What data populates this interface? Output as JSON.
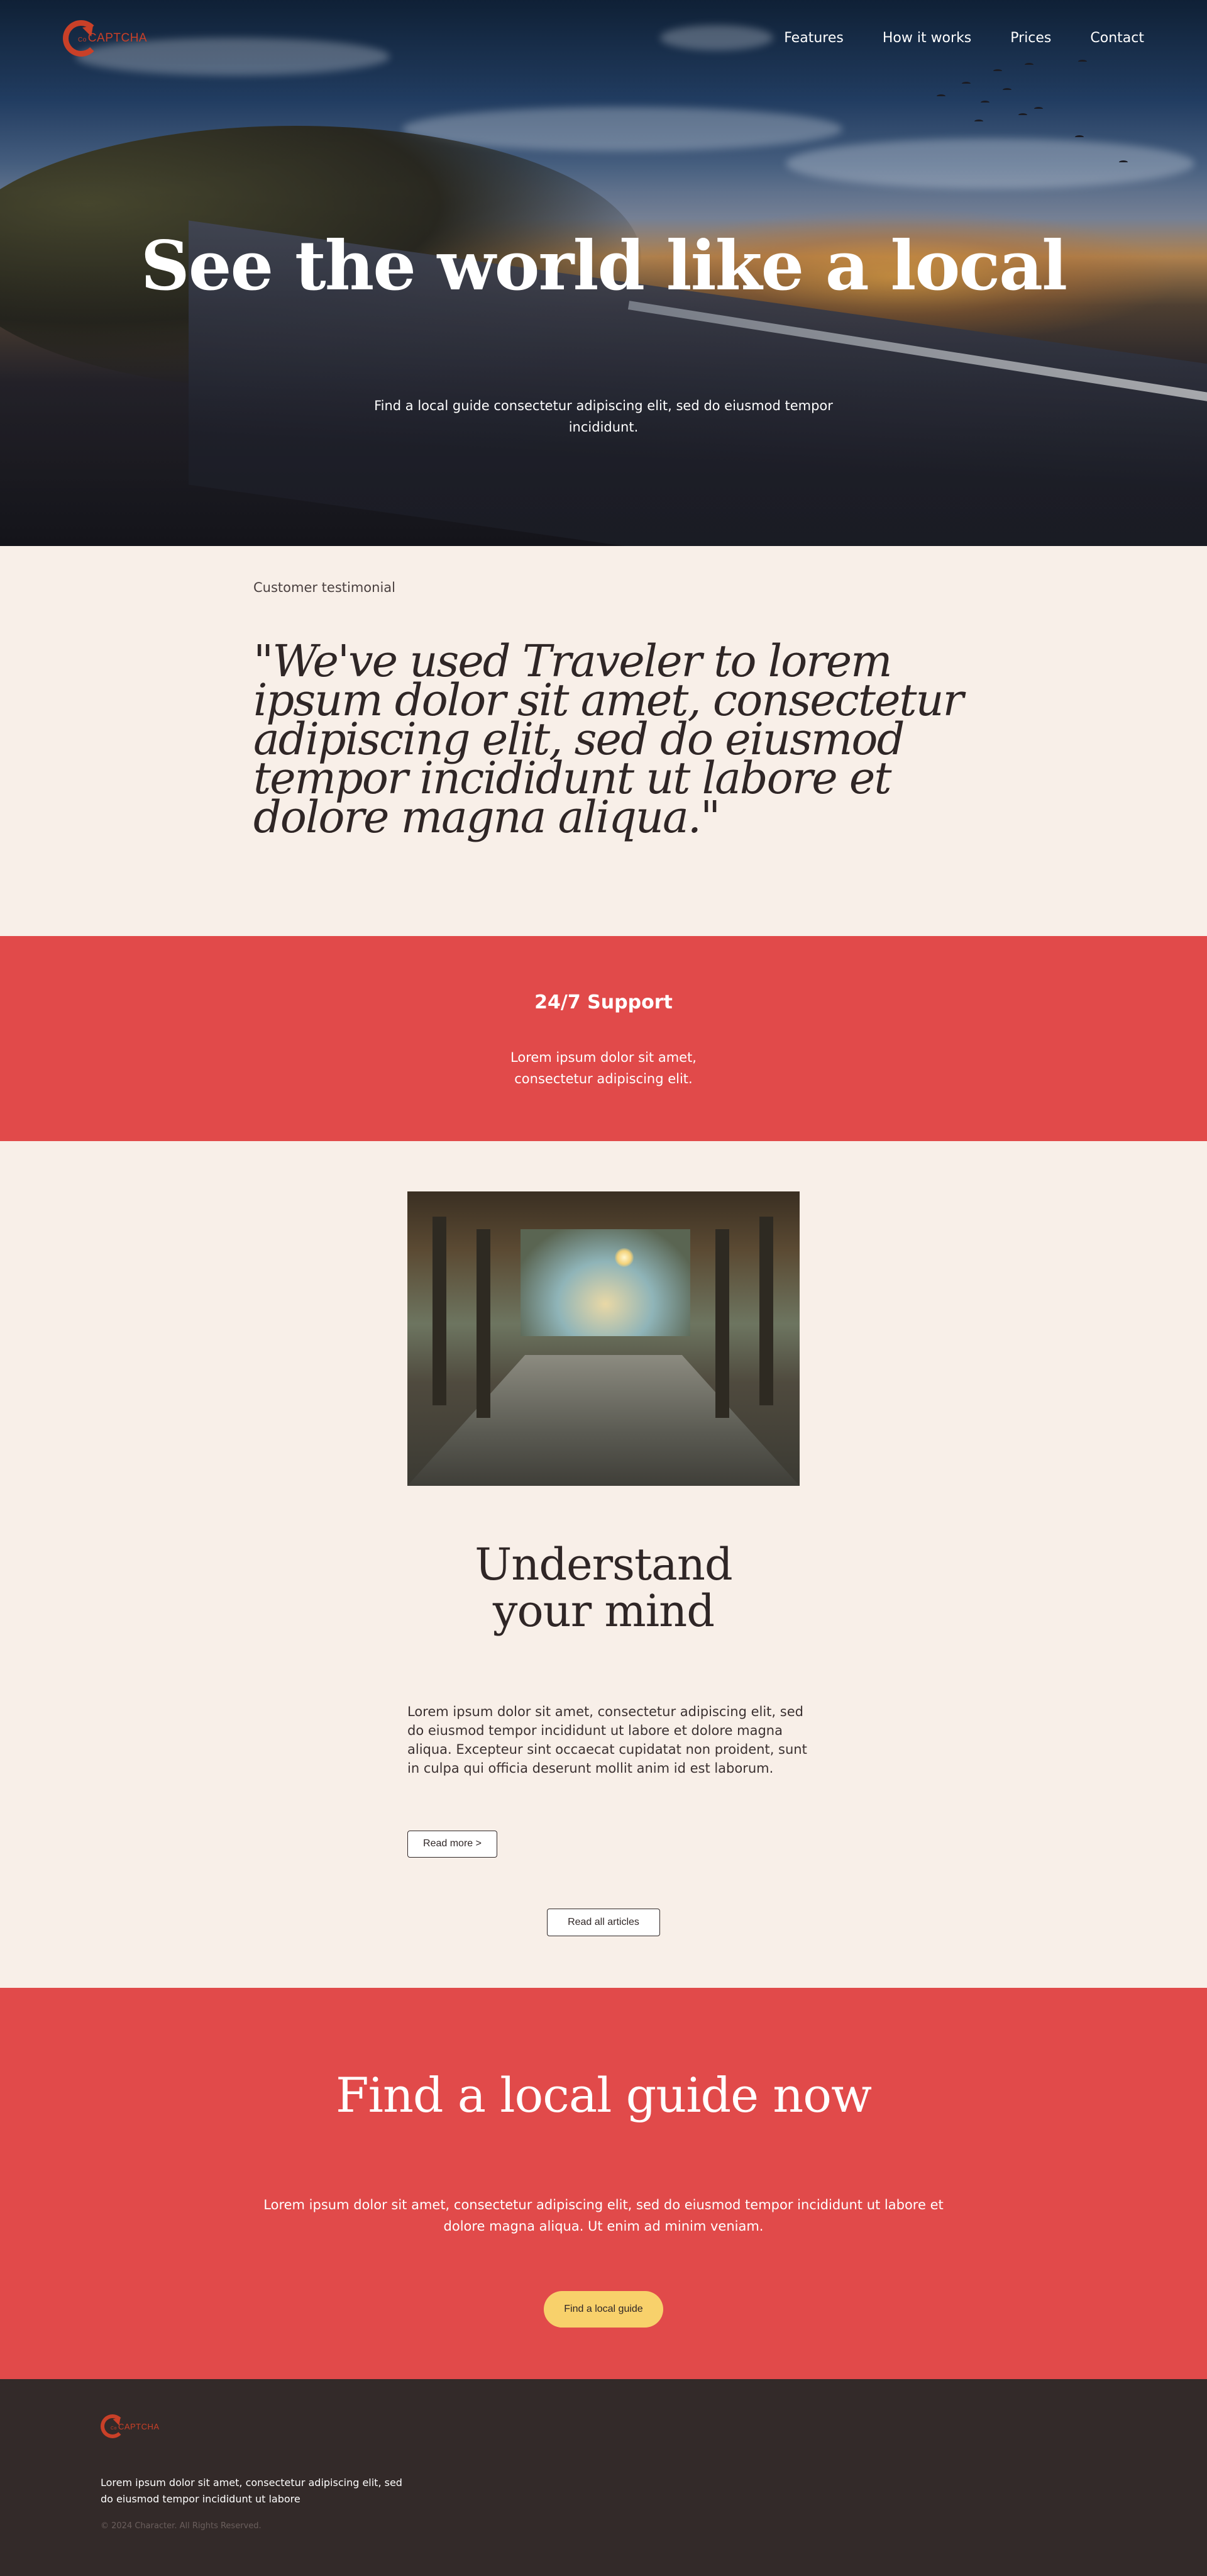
{
  "brand": {
    "logo_prefix": "Co",
    "logo_text": "CAPTCHA"
  },
  "nav": {
    "items": [
      "Features",
      "How it works",
      "Prices",
      "Contact"
    ]
  },
  "hero": {
    "title": "See the world like a local",
    "subtitle": "Find a local guide consectetur adipiscing elit, sed do eiusmod tempor incididunt."
  },
  "testimonial": {
    "label": "Customer testimonial",
    "quote": "\"We've used Traveler to lorem ipsum dolor sit amet, consectetur adipiscing elit, sed do eiusmod tempor incididunt ut labore et dolore magna aliqua.\""
  },
  "support": {
    "title": "24/7 Support",
    "text": "Lorem ipsum dolor sit amet, consectetur adipiscing elit."
  },
  "article": {
    "title": "Understand your mind",
    "body": "Lorem ipsum dolor sit amet, consectetur adipiscing elit, sed do eiusmod tempor incididunt ut labore et dolore magna aliqua. Excepteur sint occaecat cupidatat non proident, sunt in culpa qui officia deserunt mollit anim id est laborum.",
    "read_more": "Read more >",
    "read_all": "Read all articles"
  },
  "cta": {
    "title": "Find a local guide now",
    "text": "Lorem ipsum dolor sit amet, consectetur adipiscing elit, sed do eiusmod tempor incididunt ut labore et dolore magna aliqua. Ut enim ad minim veniam.",
    "button": "Find a local guide"
  },
  "footer": {
    "text": "Lorem ipsum dolor sit amet, consectetur adipiscing elit, sed do eiusmod tempor incididunt ut labore",
    "copyright": "© 2024 Character. All Rights Reserved."
  },
  "colors": {
    "accent_red": "#e14a4a",
    "logo_red": "#c94028",
    "cta_yellow": "#f8d16b",
    "background_cream": "#f8efe8",
    "footer_dark": "#332a29"
  },
  "icons": {
    "logo": "circular-arrow-logo-icon"
  }
}
